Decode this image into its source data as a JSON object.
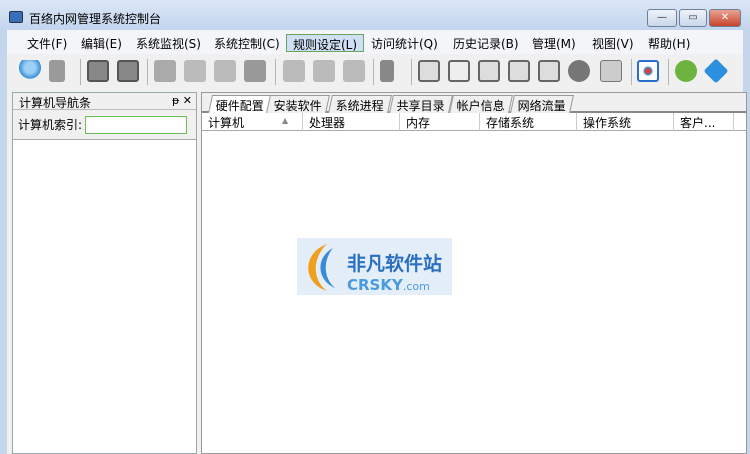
{
  "window": {
    "title": "百络内网管理系统控制台",
    "min": "—",
    "max": "▭",
    "close": "✕"
  },
  "menu": [
    "文件(F)",
    "编辑(E)",
    "系统监视(S)",
    "系统控制(C)",
    "规则设定(L)",
    "访问统计(Q)",
    "历史记录(B)",
    "管理(M)",
    "视图(V)",
    "帮助(H)"
  ],
  "toolbar": [
    "user-icon",
    "logout-icon",
    "monitor-icon",
    "stop-icon",
    "book-icon",
    "printer-icon",
    "picture-icon",
    "documents-icon",
    "new-doc-icon",
    "edit-doc-icon",
    "delete-doc-icon",
    "speaker-icon",
    "screen-icon",
    "page-icon",
    "disk-icon",
    "browser-icon",
    "settings-icon",
    "refresh-icon",
    "calendar-icon",
    "grid-icon",
    "help-icon",
    "info-icon"
  ],
  "nav": {
    "title": "计算机导航条",
    "pin": "ᵽ",
    "close": "✕",
    "search_label": "计算机索引:",
    "search_value": ""
  },
  "tabs": [
    "硬件配置",
    "安装软件",
    "系统进程",
    "共享目录",
    "帐户信息",
    "网络流量"
  ],
  "columns": [
    "计算机",
    "处理器",
    "内存",
    "存储系统",
    "操作系统",
    "客户..."
  ],
  "sort_indicator": "▲",
  "watermark": {
    "line1": "非凡软件站",
    "line2": "CRSKY.com"
  }
}
